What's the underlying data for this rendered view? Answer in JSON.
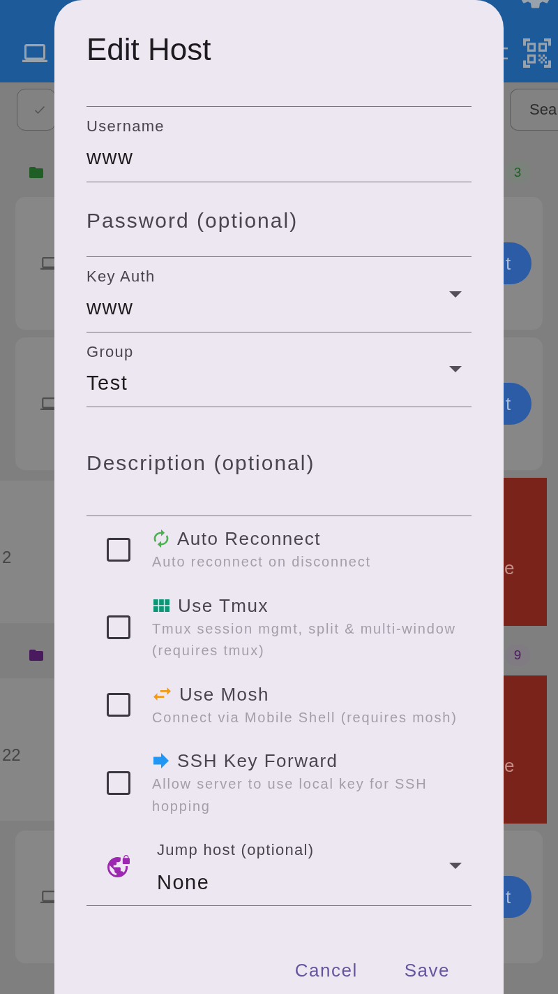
{
  "background": {
    "search": {
      "placeholder": "Sea"
    },
    "groups": [
      {
        "color": "#1f5e24",
        "count": "3",
        "hosts": [
          {
            "kind": "card",
            "action": "t"
          },
          {
            "kind": "card",
            "action": "t"
          },
          {
            "kind": "swiped",
            "text": "2",
            "action": "e"
          }
        ]
      },
      {
        "color": "#4a1a5e",
        "count": "9",
        "hosts": [
          {
            "kind": "swiped",
            "text": "22",
            "action": "e"
          },
          {
            "kind": "card",
            "action": "t"
          }
        ]
      }
    ]
  },
  "dialog": {
    "title": "Edit Host",
    "fields": [
      {
        "kind": "text",
        "label": "Username",
        "value": "www"
      },
      {
        "kind": "text",
        "label": "Password (optional)"
      },
      {
        "kind": "dropdown",
        "label": "Key Auth",
        "value": "www"
      },
      {
        "kind": "dropdown",
        "label": "Group",
        "value": "Test"
      },
      {
        "kind": "multiline",
        "label": "Description (optional)"
      }
    ],
    "options": [
      {
        "title": "Auto Reconnect",
        "description": "Auto reconnect on disconnect",
        "checked": false
      },
      {
        "title": "Use Tmux",
        "description": "Tmux session mgmt, split & multi-window (requires tmux)",
        "checked": false
      },
      {
        "title": "Use Mosh",
        "description": "Connect via Mobile Shell (requires mosh)",
        "checked": false
      },
      {
        "title": "SSH Key Forward",
        "description": "Allow server to use local key for SSH hopping",
        "checked": false
      }
    ],
    "jump_host": {
      "label": "Jump host (optional)",
      "value": "None"
    },
    "buttons": [
      "Cancel",
      "Save"
    ]
  }
}
